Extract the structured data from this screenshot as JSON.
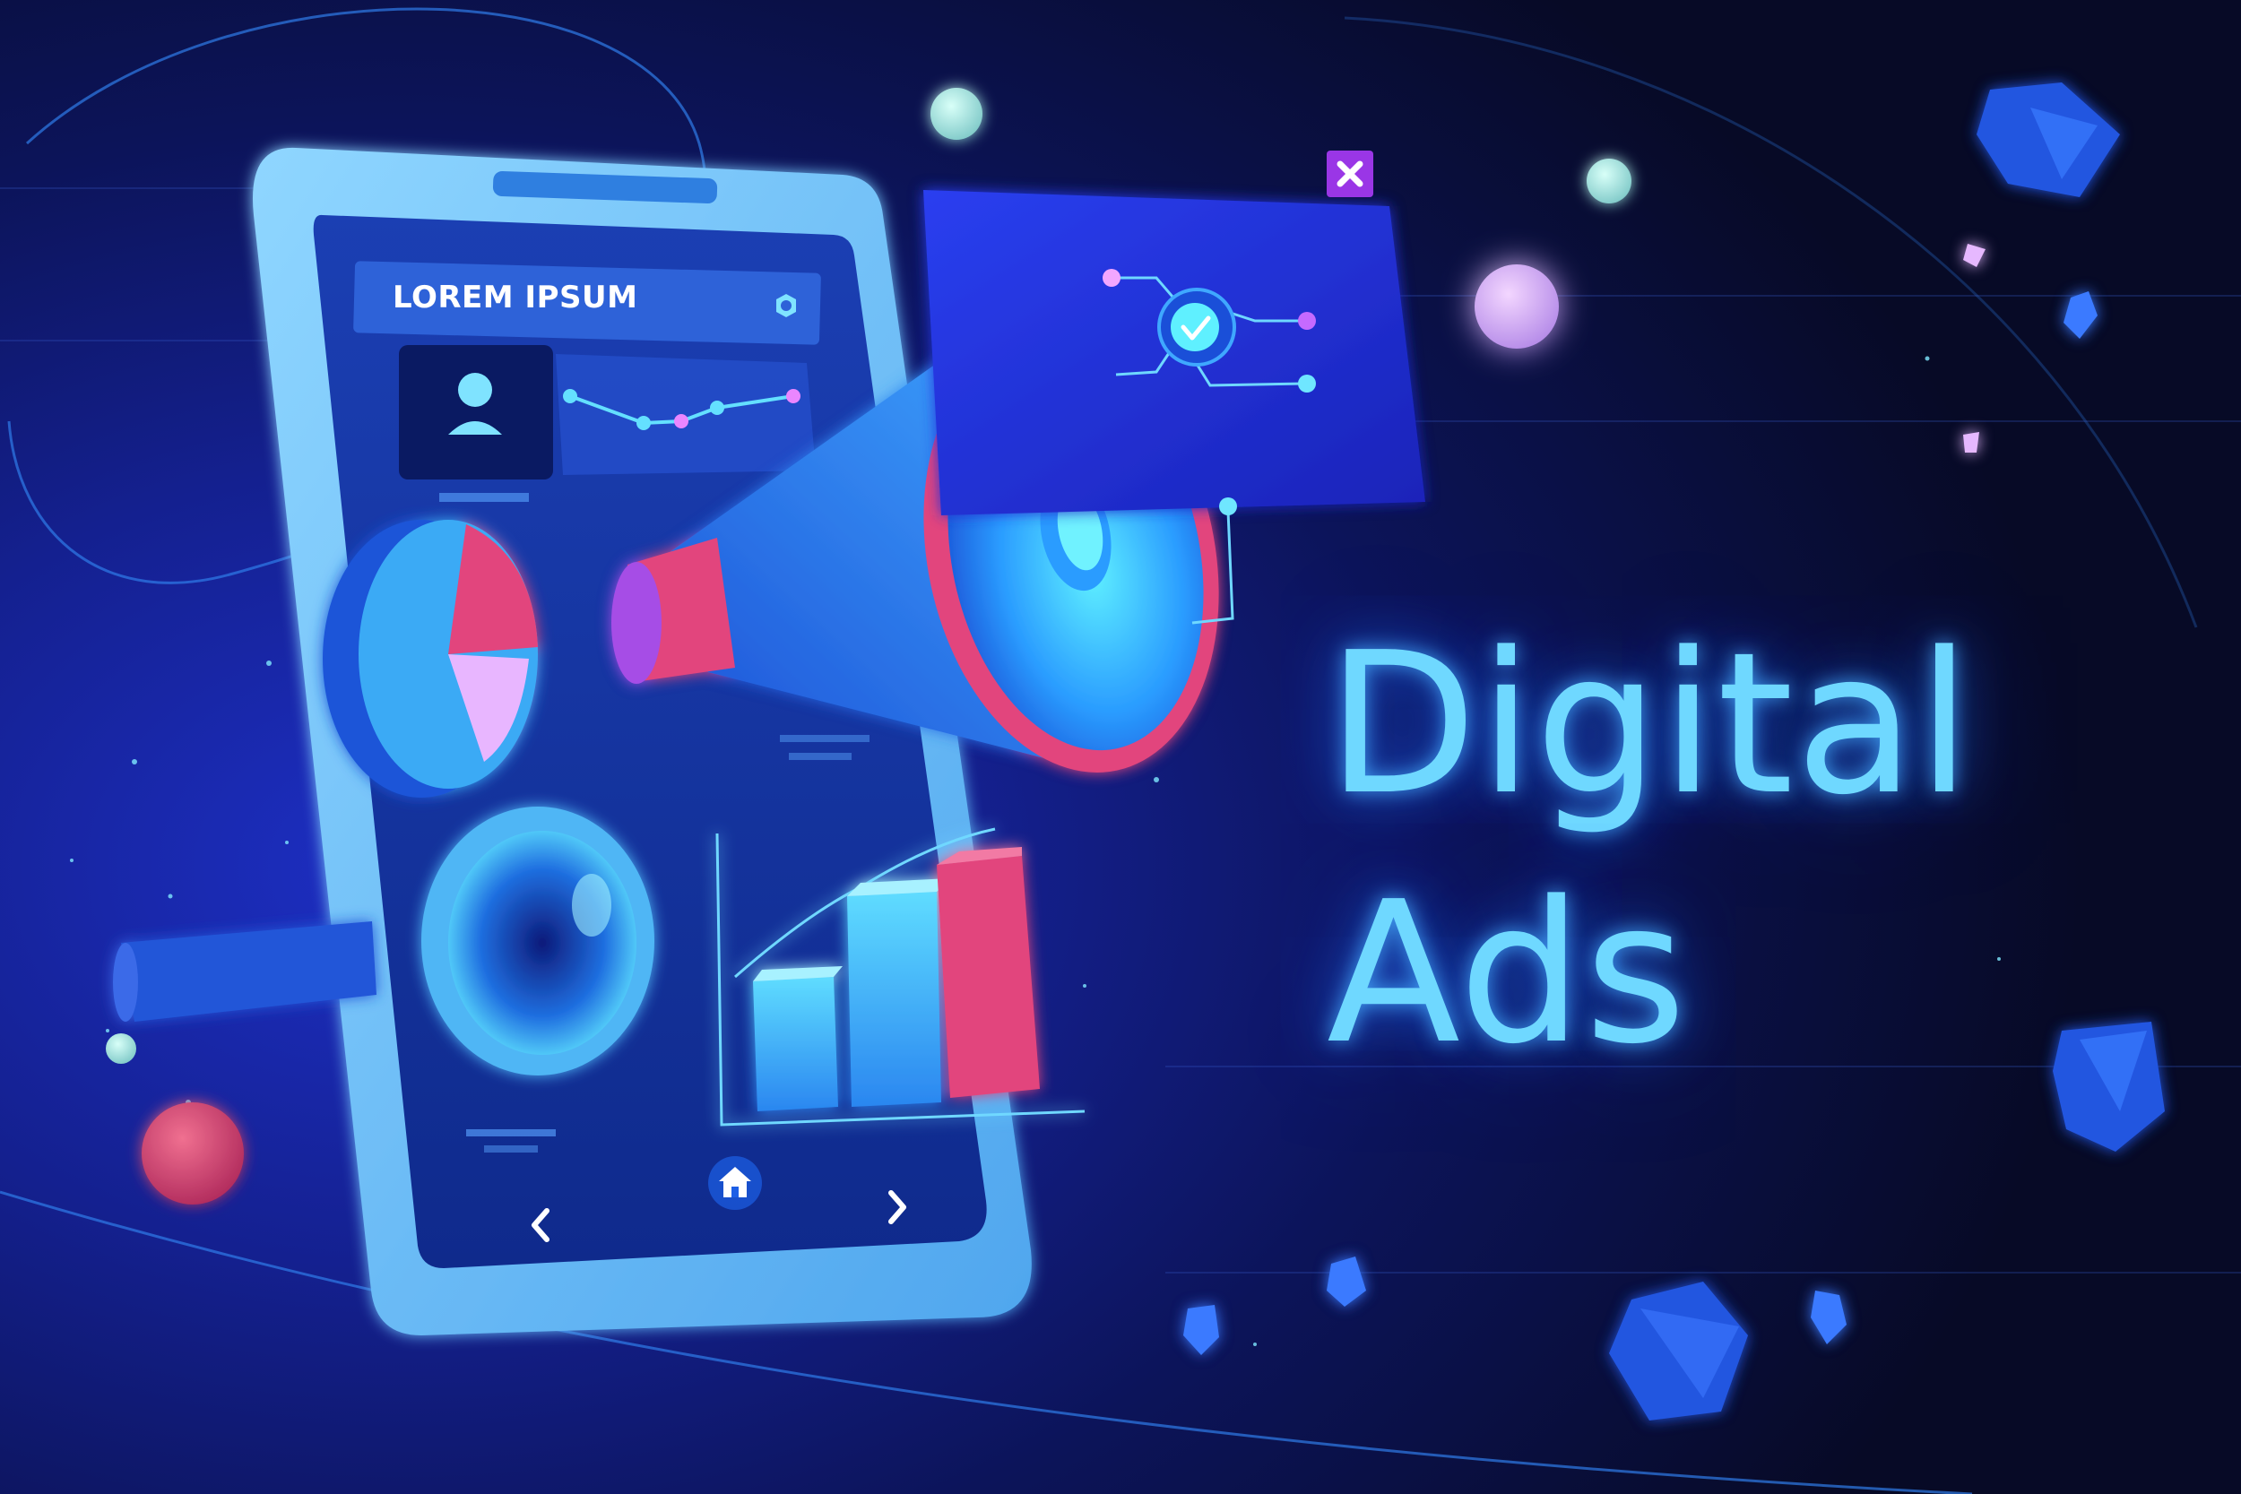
{
  "headline": {
    "line1": "Digital",
    "line2": "Ads"
  },
  "phone_app": {
    "header_title": "LOREM IPSUM",
    "settings_icon": "gear-icon",
    "profile_icon": "user-icon",
    "nav": {
      "back_icon": "chevron-left-icon",
      "home_icon": "home-icon",
      "forward_icon": "chevron-right-icon"
    }
  },
  "popup": {
    "close_icon": "close-icon",
    "check_icon": "checkmark-icon"
  },
  "colors": {
    "background_dark": "#070a26",
    "background_glow": "#1d2fc4",
    "accent_cyan": "#6fd8ff",
    "accent_pink": "#e2457d",
    "accent_purple": "#a64de6",
    "phone_frame": "#6fc3f5"
  }
}
